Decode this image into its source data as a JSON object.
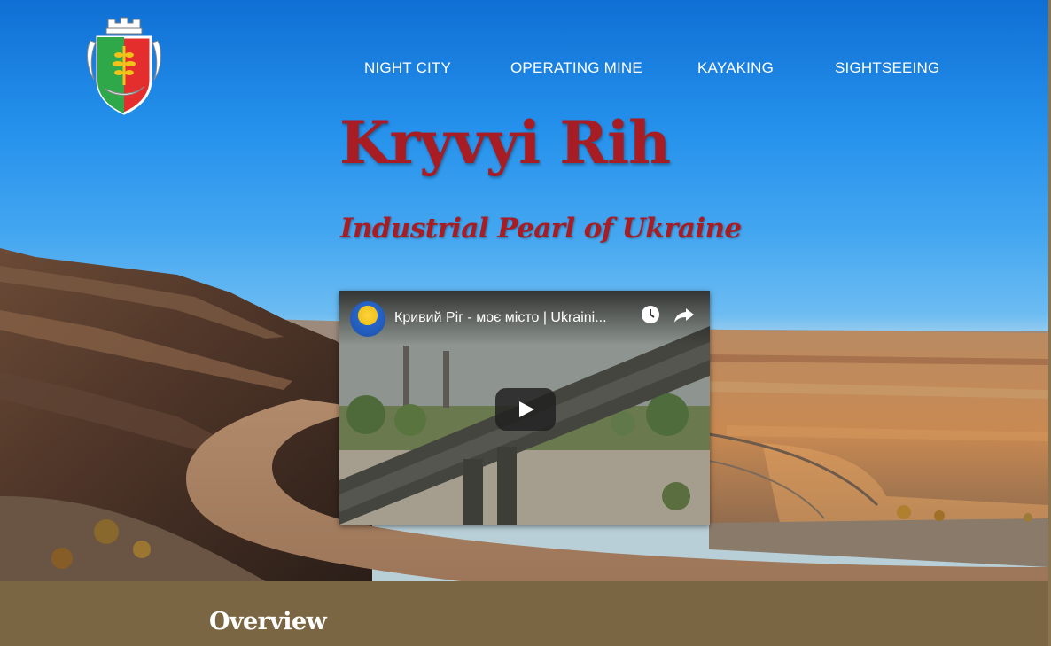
{
  "logo": {
    "icon": "city-coat-of-arms-icon"
  },
  "nav": {
    "items": [
      {
        "label": "NIGHT CITY"
      },
      {
        "label": "OPERATING MINE"
      },
      {
        "label": "KAYAKING"
      },
      {
        "label": "SIGHTSEEING"
      }
    ]
  },
  "hero": {
    "title": "Kryvyi Rih",
    "subtitle": "Industrial Pearl of Ukraine"
  },
  "video": {
    "title": "Кривий Ріг - моє місто | Ukraini...",
    "channel_icon": "channel-avatar-icon",
    "watch_later_icon": "clock-icon",
    "share_icon": "share-icon",
    "play_icon": "play-icon"
  },
  "sections": {
    "overview_heading": "Overview"
  },
  "colors": {
    "accent_red": "#a81c23",
    "band_brown": "#7a6643",
    "sky_blue": "#2591ec"
  }
}
